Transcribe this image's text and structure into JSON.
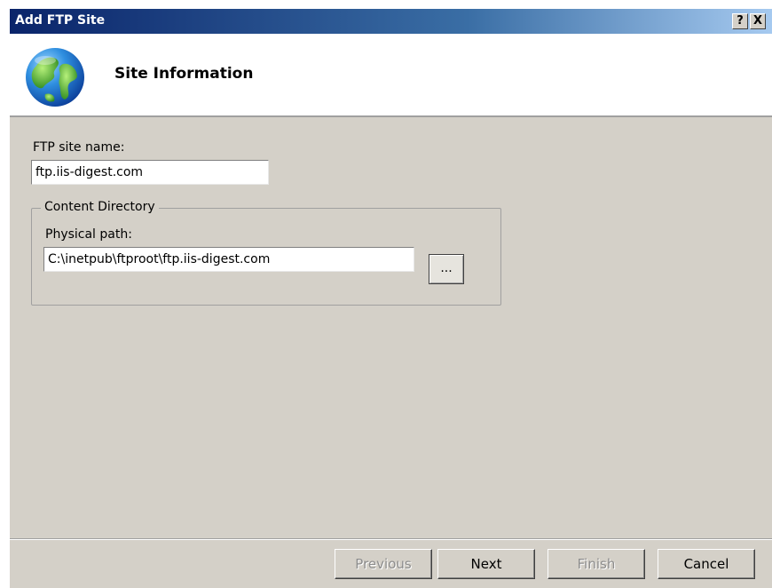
{
  "window": {
    "title": "Add FTP Site",
    "help_label": "?",
    "close_label": "X"
  },
  "header": {
    "title": "Site Information",
    "icon": "globe-icon"
  },
  "form": {
    "site_name_label": "FTP site name:",
    "site_name_value": "ftp.iis-digest.com",
    "content_directory_label": "Content Directory",
    "physical_path_label": "Physical path:",
    "physical_path_value": "C:\\inetpub\\ftproot\\ftp.iis-digest.com",
    "browse_label": "..."
  },
  "buttons": {
    "previous": "Previous",
    "next": "Next",
    "finish": "Finish",
    "cancel": "Cancel"
  },
  "colors": {
    "dialog_background": "#d4d0c8",
    "titlebar_start": "#0a246a",
    "titlebar_end": "#a6caf0"
  }
}
